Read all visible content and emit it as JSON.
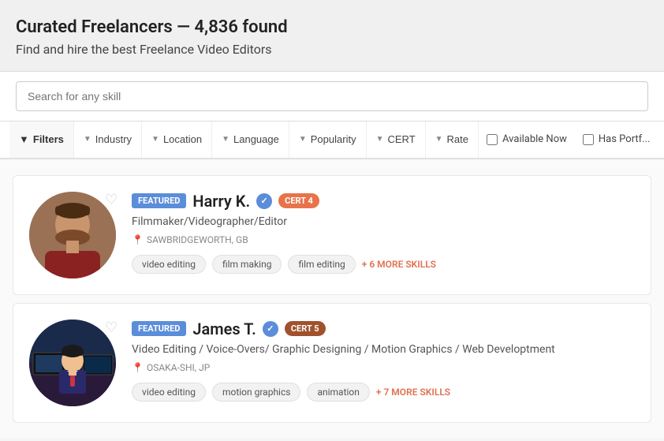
{
  "header": {
    "title": "Curated Freelancers — 4,836 found",
    "subtitle": "Find and hire the best Freelance Video Editors"
  },
  "search": {
    "placeholder": "Search for any skill"
  },
  "filters": {
    "filter_label": "Filters",
    "industry_label": "Industry",
    "location_label": "Location",
    "language_label": "Language",
    "popularity_label": "Popularity",
    "cert_label": "CERT",
    "rate_label": "Rate",
    "available_now_label": "Available Now",
    "has_portfolio_label": "Has Portf..."
  },
  "freelancers": [
    {
      "featured_label": "FEATURED",
      "name": "Harry K.",
      "cert": "CERT 4",
      "cert_class": "cert-badge",
      "title": "Filmmaker/Videographer/Editor",
      "location": "SAWBRIDGEWORTH, GB",
      "skills": [
        "video editing",
        "film making",
        "film editing"
      ],
      "more_skills_label": "+ 6 MORE SKILLS"
    },
    {
      "featured_label": "FEATURED",
      "name": "James T.",
      "cert": "CERT 5",
      "cert_class": "cert-badge cert-badge-5",
      "title": "Video Editing / Voice-Overs/ Graphic Designing / Motion Graphics / Web Developtment",
      "location": "OSAKA-SHI, JP",
      "skills": [
        "video editing",
        "motion graphics",
        "animation"
      ],
      "more_skills_label": "+ 7 MORE SKILLS"
    }
  ]
}
